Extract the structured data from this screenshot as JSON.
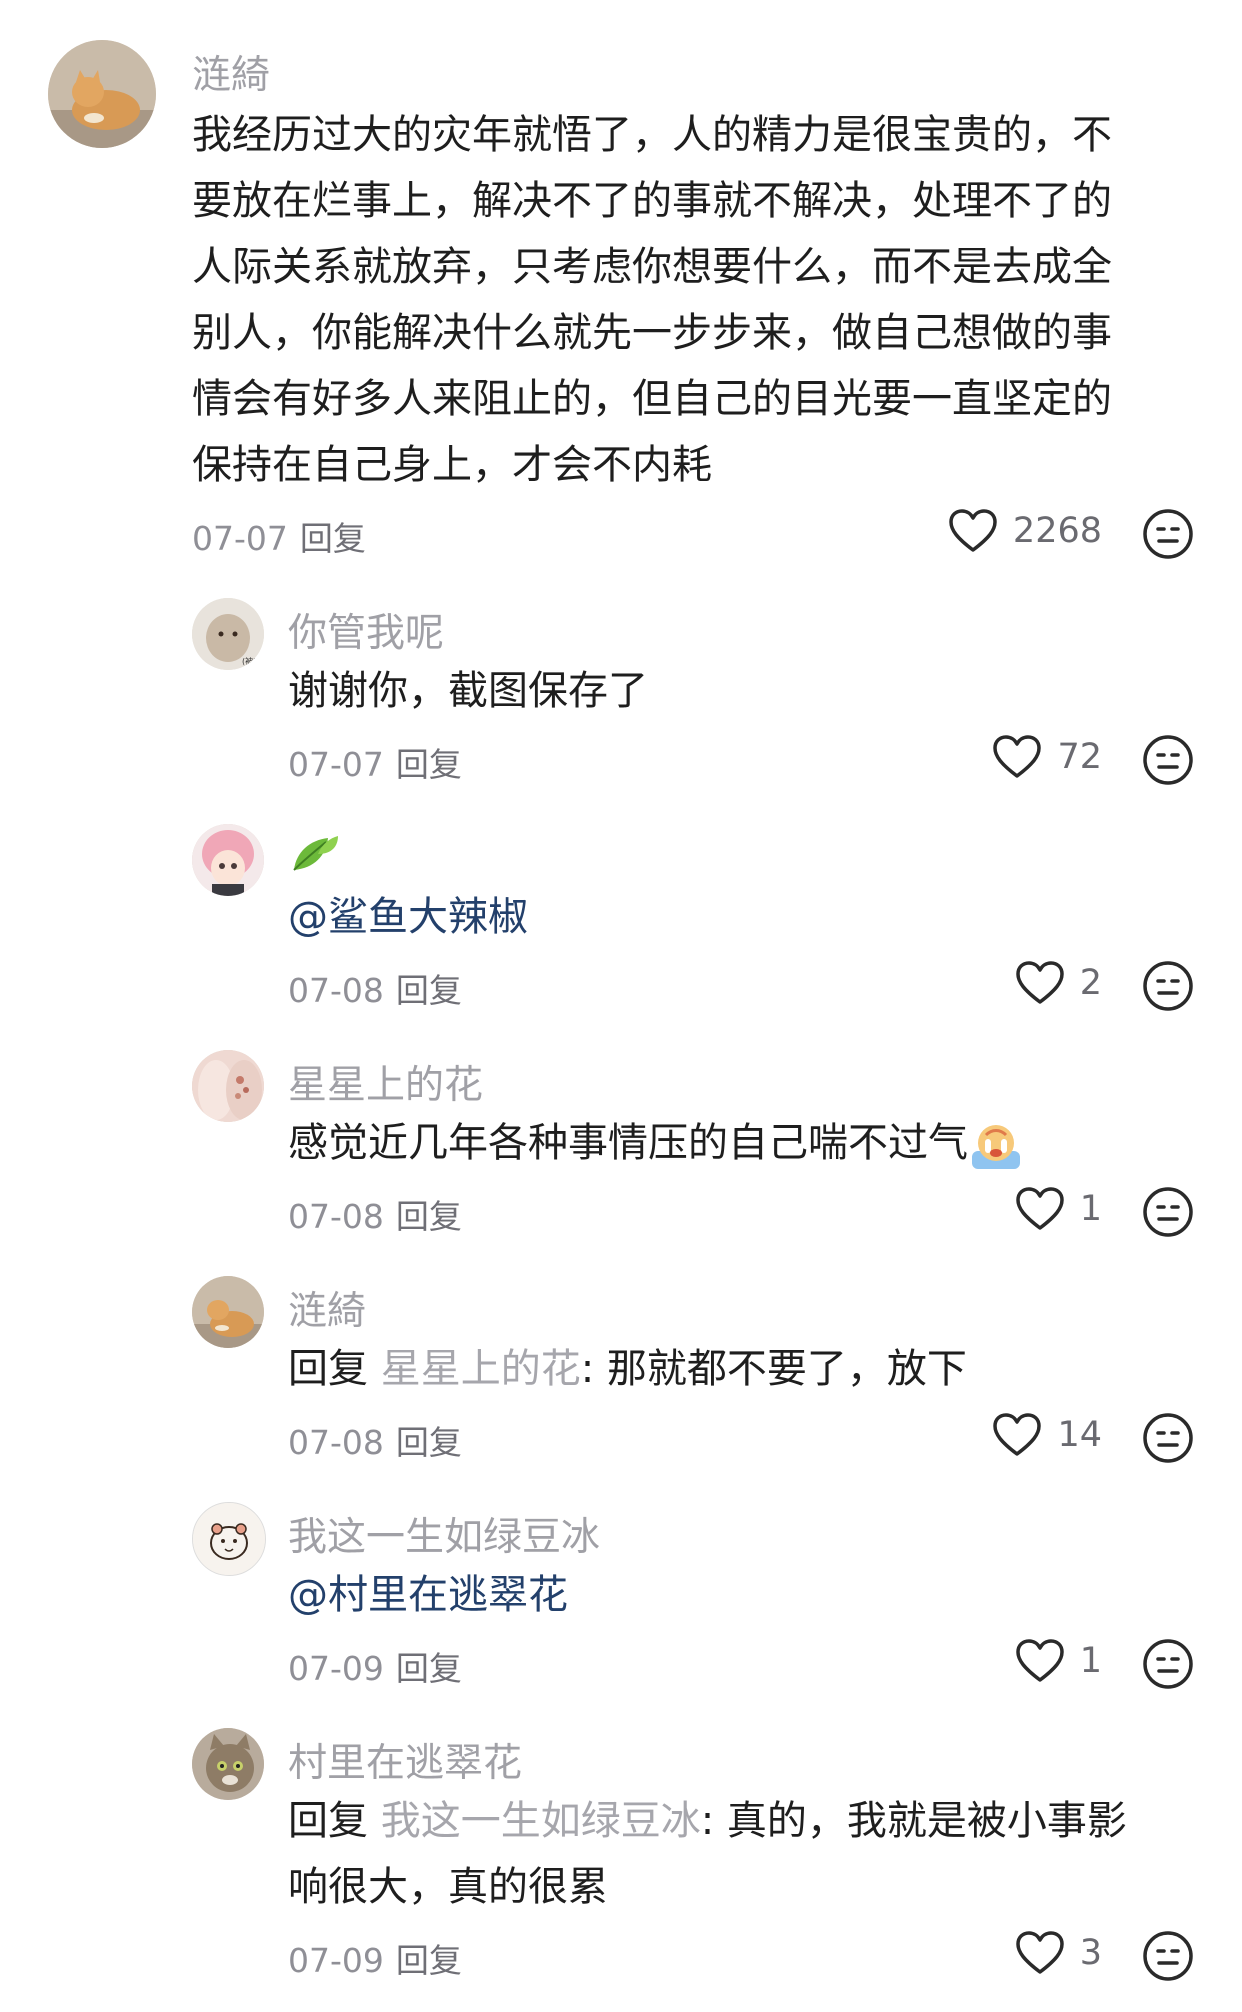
{
  "comments": [
    {
      "name": "涟綺",
      "lines": [
        "我经历过大的灾年就悟了，人的精力是很宝贵的，不",
        "要放在烂事上，解决不了的事就不解决，处理不了的",
        "人际关系就放弃，只考虑你想要什么，而不是去成全",
        "别人，你能解决什么就先一步步来，做自己想做的事",
        "情会有好多人来阻止的，但自己的目光要一直坚定的",
        "保持在自己身上，才会不内耗"
      ],
      "date": "07-07",
      "reply_label": "回复",
      "likes": "2268"
    }
  ],
  "replies": [
    {
      "name": "你管我呢",
      "text": "谢谢你，截图保存了",
      "date": "07-07",
      "reply_label": "回复",
      "likes": "72",
      "avatar_text": "(被动)"
    },
    {
      "name": "",
      "mention": "@鲨鱼大辣椒",
      "date": "07-08",
      "reply_label": "回复",
      "likes": "2"
    },
    {
      "name": "星星上的花",
      "text": "感觉近几年各种事情压的自己喘不过气",
      "date": "07-08",
      "reply_label": "回复",
      "likes": "1"
    },
    {
      "name": "涟綺",
      "prefix": "回复 ",
      "reply_to": "星星上的花",
      "text": ": 那就都不要了，放下",
      "date": "07-08",
      "reply_label": "回复",
      "likes": "14"
    },
    {
      "name": "我这一生如绿豆冰",
      "mention": " @村里在逃翠花",
      "date": "07-09",
      "reply_label": "回复",
      "likes": "1"
    },
    {
      "name": "村里在逃翠花",
      "prefix": "回复 ",
      "reply_to": "我这一生如绿豆冰",
      "text": ": 真的，我就是被小事影",
      "text2": "响很大，真的很累",
      "date": "07-09",
      "reply_label": "回复",
      "likes": "3"
    }
  ],
  "colors": {
    "name": "#a0a0a6",
    "body": "#1e1e1e",
    "mention": "#23406b",
    "meta": "#8f8f96"
  },
  "icons": [
    "heart-outline-icon",
    "dislike-face-icon",
    "leaf-emoji-icon",
    "crying-emoji-icon"
  ]
}
